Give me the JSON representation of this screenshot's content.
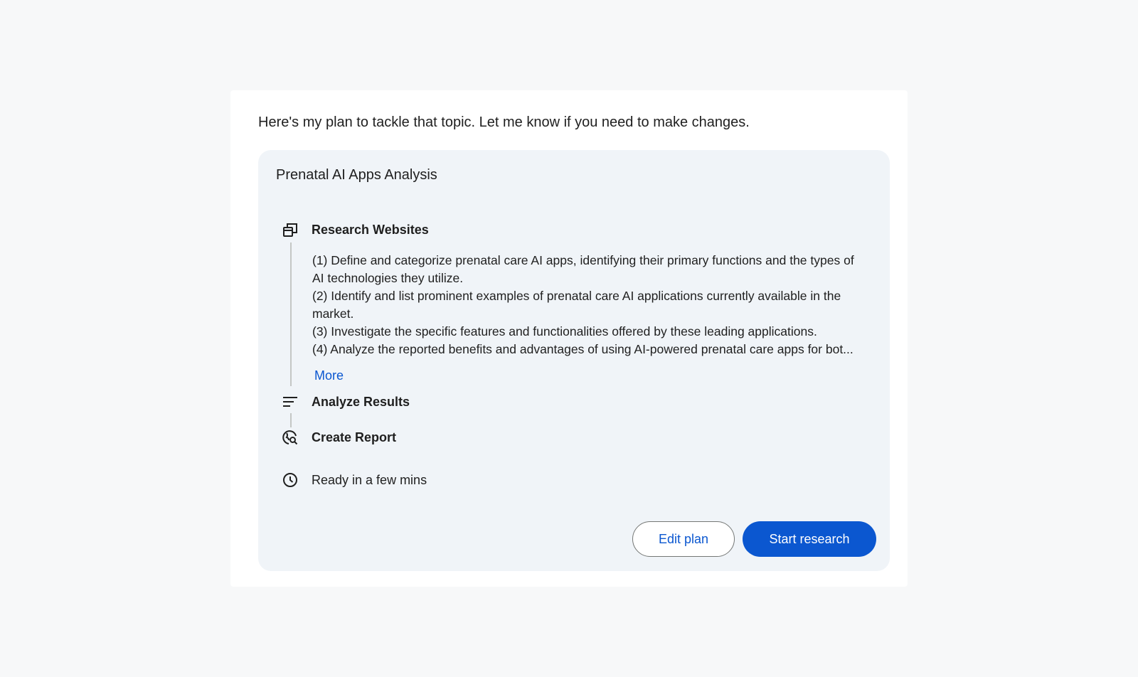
{
  "intro": "Here's my plan to tackle that topic. Let me know if you need to make changes.",
  "plan": {
    "title": "Prenatal AI Apps Analysis",
    "steps": [
      {
        "label": "Research Websites",
        "icon": "browser-windows-icon"
      },
      {
        "label": "Analyze Results",
        "icon": "sort-lines-icon"
      },
      {
        "label": "Create Report",
        "icon": "report-search-icon"
      }
    ],
    "description_lines": [
      "(1) Define and categorize prenatal care AI apps, identifying their primary functions and the types of",
      "AI technologies they utilize.",
      "(2) Identify and list prominent examples of prenatal care AI applications currently available in the",
      "market.",
      "(3) Investigate the specific features and functionalities offered by these leading applications.",
      "(4) Analyze the reported benefits and advantages of using AI-powered prenatal care apps for bot..."
    ],
    "more_label": "More",
    "eta": "Ready in a few mins",
    "eta_icon": "clock-icon"
  },
  "actions": {
    "edit_label": "Edit plan",
    "start_label": "Start research"
  },
  "colors": {
    "accent": "#0b57d0",
    "card_bg": "#f0f4f8",
    "page_bg": "#f7f8f9"
  }
}
